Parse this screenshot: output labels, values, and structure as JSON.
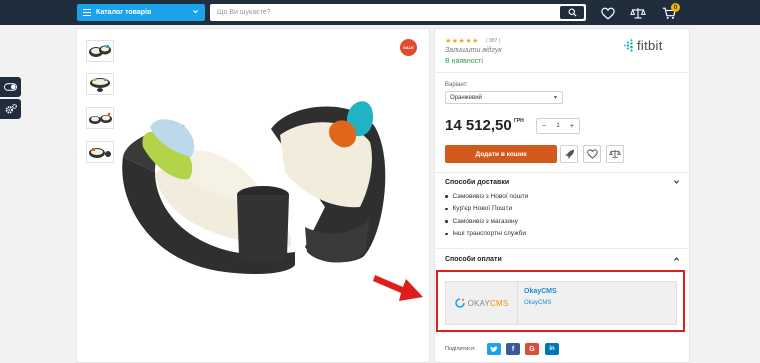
{
  "header": {
    "catalog_label": "Каталог товарів",
    "search_placeholder": "Що Ви шукаєте?",
    "cart_count": "0"
  },
  "product": {
    "sale_badge": "SALE",
    "rating_stars": "★★★★★",
    "review_count": "( 987 )",
    "write_review": "Залишити відгук",
    "availability": "В наявності",
    "brand_name": "fitbit",
    "variant_label": "Варіант:",
    "variant_value": "Оранжевий",
    "price": "14 512,50",
    "currency": "ГРН",
    "quantity": "1",
    "qty_minus": "−",
    "qty_plus": "+",
    "buy_label": "Додати в кошик"
  },
  "delivery": {
    "title": "Способи доставки",
    "items": [
      "Самовивіз з Нової пошти",
      "Кур'єр Нової Пошти",
      "Самовивіз з магазину",
      "Інші транспортні служби"
    ]
  },
  "payment": {
    "title": "Способи оплати",
    "logo_text_a": "OKAY",
    "logo_text_b": "CMS",
    "method_name": "OkayCMS",
    "method_desc": "OkayCMS"
  },
  "share": {
    "label": "Поділитися:",
    "buttons": [
      "t",
      "f",
      "G",
      "in"
    ]
  },
  "colors": {
    "header_bg": "#1f2d3d",
    "catalog_bg": "#1aa3e8",
    "buy_button": "#d35a1c",
    "highlight": "#e01d1d",
    "in_stock": "#2f9e44",
    "twitter": "#1da1f2",
    "facebook": "#3b5998",
    "google": "#dd4b39",
    "linkedin": "#0077b5"
  }
}
